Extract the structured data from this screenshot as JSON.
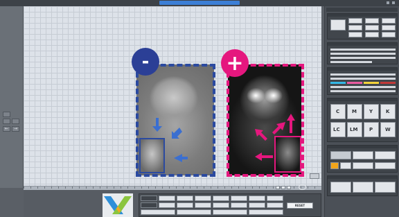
{
  "titlebar": {
    "app_title": "",
    "doc_tab": ""
  },
  "canvas": {
    "badges": {
      "minus": "-",
      "plus": "+"
    }
  },
  "bottom": {
    "reset_label": "RESET"
  },
  "right_panel": {
    "channels": [
      {
        "letter": "C"
      },
      {
        "letter": "M"
      },
      {
        "letter": "Y"
      },
      {
        "letter": "K"
      },
      {
        "letter": "LC"
      },
      {
        "letter": "LM"
      },
      {
        "letter": "P"
      },
      {
        "letter": "W"
      }
    ]
  },
  "colors": {
    "minus_accent": "#2b3f96",
    "plus_accent": "#e5177e",
    "tab_accent": "#3c7fd6"
  },
  "icons": [
    "minus-badge-icon",
    "plus-badge-icon",
    "app-logo-icon",
    "arrow-icon"
  ]
}
